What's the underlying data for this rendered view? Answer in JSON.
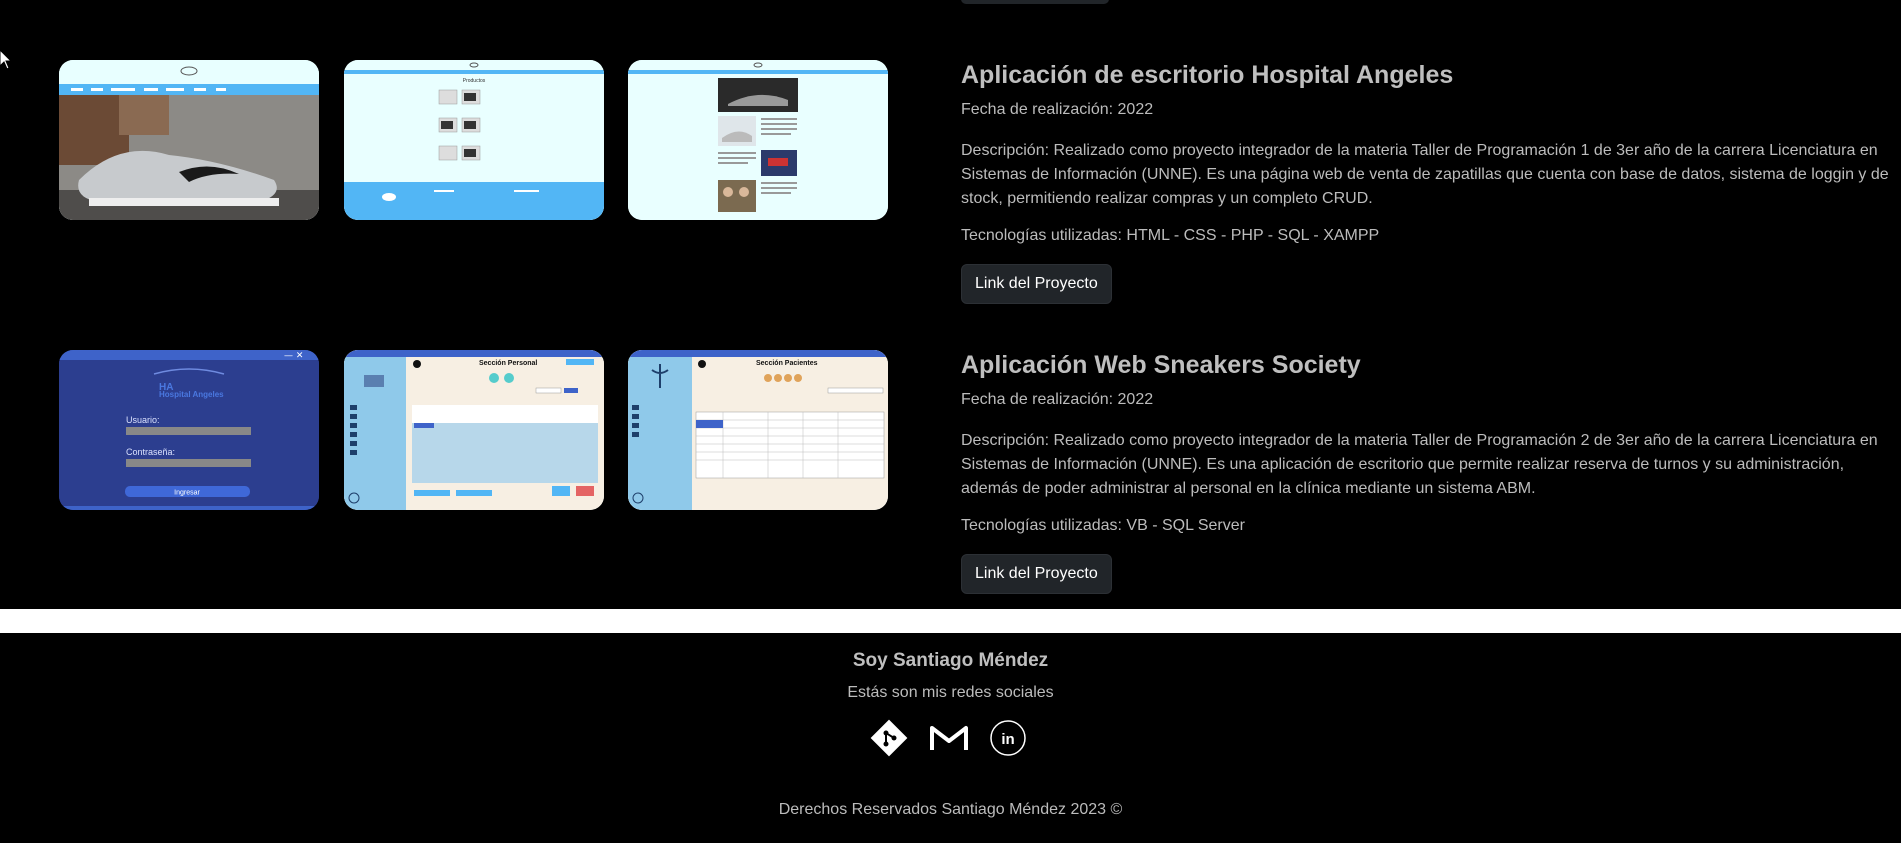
{
  "projects": [
    {
      "title": "Aplicación de escritorio Hospital Angeles",
      "date": "Fecha de realización: 2022",
      "description": "Descripción: Realizado como proyecto integrador de la materia Taller de Programación 1 de 3er año de la carrera Licenciatura en Sistemas de Información (UNNE). Es una página web de venta de zapatillas que cuenta con base de datos, sistema de loggin y de stock, permitiendo realizar compras y un completo CRUD.",
      "tech": "Tecnologías utilizadas: HTML - CSS - PHP - SQL - XAMPP",
      "link_label": "Link del Proyecto"
    },
    {
      "title": "Aplicación Web Sneakers Society",
      "date": "Fecha de realización: 2022",
      "description": "Descripción: Realizado como proyecto integrador de la materia Taller de Programación 2 de 3er año de la carrera Licenciatura en Sistemas de Información (UNNE). Es una aplicación de escritorio que permite realizar reserva de turnos y su administración, además de poder administrar al personal en la clínica mediante un sistema ABM.",
      "tech": "Tecnologías utilizadas: VB - SQL Server",
      "link_label": "Link del Proyecto"
    }
  ],
  "thumbnails": {
    "hospital_login": {
      "brand": "Hospital Angeles",
      "user_label": "Usuario:",
      "pass_label": "Contraseña:",
      "submit": "Ingresar"
    },
    "personal": {
      "heading": "Sección Personal"
    },
    "pacientes": {
      "heading": "Sección Pacientes"
    },
    "product_page": {
      "heading": "Productos"
    }
  },
  "footer": {
    "name": "Soy Santiago Méndez",
    "subtitle": "Estás son mis redes sociales",
    "copyright": "Derechos Reservados Santiago Méndez 2023 ©",
    "icons": [
      "git-icon",
      "gmail-icon",
      "linkedin-icon"
    ]
  },
  "colors": {
    "background": "#000000",
    "button": "#212529",
    "thumb_blue": "#52b6f5",
    "hospital_navy": "#2c3e8f"
  }
}
